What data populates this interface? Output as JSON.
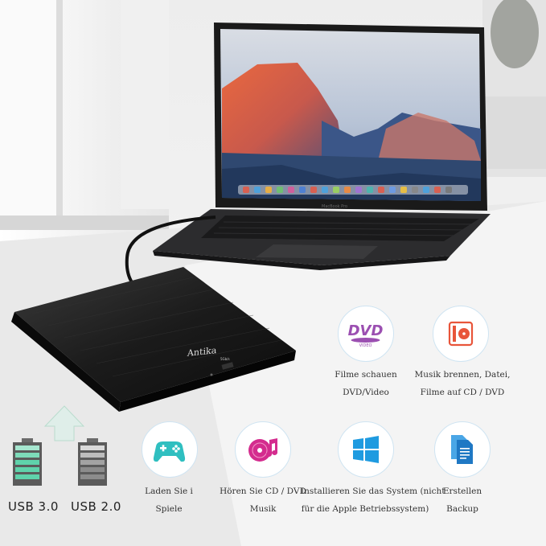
{
  "product": {
    "brand": "Antika",
    "port_label": "5Gb/s",
    "laptop_label": "MacBook Pro"
  },
  "usb": {
    "usb3_label": "USB  3.0",
    "usb2_label": "USB  2.0",
    "usb3_color": "#5fd3ab",
    "usb2_color": "#8c8c8c"
  },
  "features": [
    {
      "icon": "dvd-video-icon",
      "line1": "Filme schauen",
      "line2": "DVD/Video",
      "color": "#9b4fb1"
    },
    {
      "icon": "burn-disc-icon",
      "line1": "Musik brennen, Datei,",
      "line2": "Filme auf CD / DVD",
      "color": "#e8553a"
    },
    {
      "icon": "gamepad-icon",
      "line1": "Laden Sie i",
      "line2": "Spiele",
      "color": "#2fbfc0"
    },
    {
      "icon": "music-disc-icon",
      "line1": "Hören Sie CD / DVD",
      "line2": "Musik",
      "color": "#d42c8e"
    },
    {
      "icon": "windows-icon",
      "line1": "Installieren Sie das System (nicht",
      "line2": "für die Apple Betriebssystem)",
      "color": "#1f9be0"
    },
    {
      "icon": "document-backup-icon",
      "line1": "Erstellen",
      "line2": "Backup",
      "color": "#1f78c4"
    }
  ]
}
